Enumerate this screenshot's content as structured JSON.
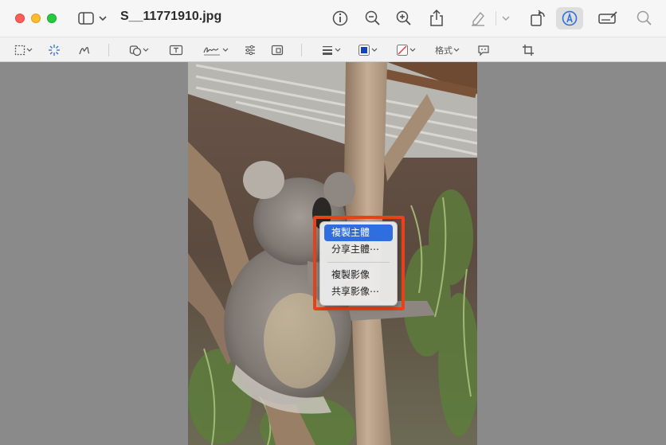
{
  "window": {
    "title": "S__11771910.jpg"
  },
  "toolbar": {
    "icons": [
      "sidebar-icon",
      "info-icon",
      "zoom-out-icon",
      "zoom-in-icon",
      "share-icon",
      "highlight-pen-icon",
      "rotate-icon",
      "markup-icon",
      "signature-toolbar-icon",
      "search-icon"
    ]
  },
  "markup_bar": {
    "format_label": "格式"
  },
  "context_menu": {
    "items": [
      {
        "label": "複製主體",
        "selected": true
      },
      {
        "label": "分享主體⋯"
      },
      {
        "label": "複製影像"
      },
      {
        "label": "共享影像⋯"
      }
    ]
  },
  "colors": {
    "accent": "#2f6ee0",
    "highlight_border": "#e8431a",
    "background": "#8a8a8a"
  }
}
